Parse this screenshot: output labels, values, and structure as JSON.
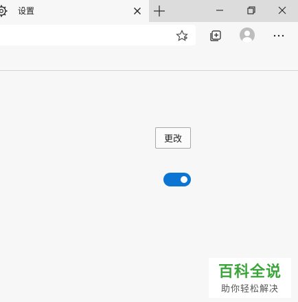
{
  "tab": {
    "title": "设置",
    "icon": "gear-icon",
    "close_icon": "close-icon"
  },
  "window_controls": {
    "new_tab_icon": "plus-icon",
    "minimize_icon": "minimize-icon",
    "restore_icon": "restore-icon",
    "close_icon": "close-icon"
  },
  "toolbar": {
    "favorite_icon": "star-icon",
    "collections_icon": "collections-icon",
    "profile_icon": "avatar",
    "more_icon": "more-icon"
  },
  "content": {
    "change_button_label": "更改",
    "toggle_on": true,
    "toggle_color": "#0c74d3"
  },
  "watermark": {
    "main": "百科全说",
    "sub": "助你轻松解决"
  }
}
